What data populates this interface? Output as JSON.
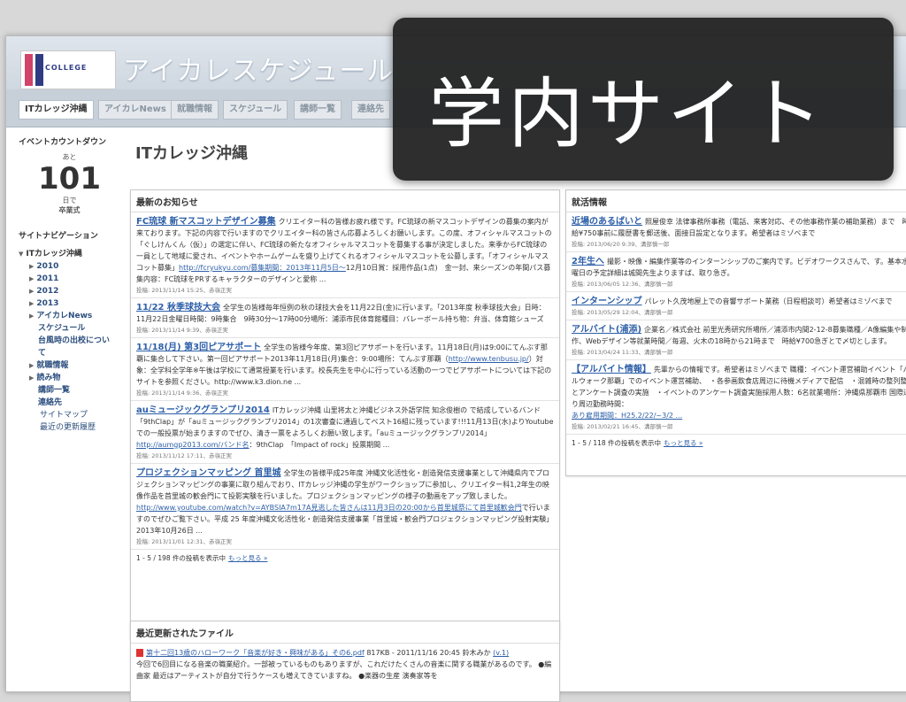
{
  "overlay": {
    "title": "学内サイト"
  },
  "site": {
    "logo_text": "COLLEGE",
    "title": "アイカレスケジュール"
  },
  "tabs": [
    "ITカレッジ沖縄",
    "アイカレNews",
    "就職情報",
    "スケジュール",
    "講師一覧",
    "連絡先"
  ],
  "sidebar": {
    "countdown_title": "イベントカウントダウン",
    "count_prefix": "あと",
    "count_value": "101",
    "count_unit": "日で",
    "count_event": "卒業式",
    "nav_title": "サイトナビゲーション",
    "nav": [
      {
        "label": "ITカレッジ沖縄",
        "level": 0,
        "arrow": "▼"
      },
      {
        "label": "2010",
        "level": 1,
        "arrow": "▶"
      },
      {
        "label": "2011",
        "level": 1,
        "arrow": "▶"
      },
      {
        "label": "2012",
        "level": 1,
        "arrow": "▶"
      },
      {
        "label": "2013",
        "level": 1,
        "arrow": "▶"
      },
      {
        "label": "アイカレNews",
        "level": 1,
        "arrow": "▶"
      },
      {
        "label": "スケジュール",
        "level": 2,
        "arrow": ""
      },
      {
        "label": "台風時の出校につい",
        "level": 2,
        "arrow": ""
      },
      {
        "label": "て",
        "level": 2,
        "arrow": ""
      },
      {
        "label": "就職情報",
        "level": 1,
        "arrow": "▶"
      },
      {
        "label": "読み物",
        "level": 1,
        "arrow": "▶"
      },
      {
        "label": "講師一覧",
        "level": 2,
        "arrow": ""
      },
      {
        "label": "連絡先",
        "level": 2,
        "arrow": ""
      },
      {
        "label": "サイトマップ",
        "level": 3,
        "arrow": ""
      },
      {
        "label": "最近の更新履歴",
        "level": 3,
        "arrow": ""
      }
    ]
  },
  "page_title": "ITカレッジ沖縄",
  "news": {
    "heading": "最新のお知らせ",
    "items": [
      {
        "title": "FC琉球 新マスコットデザイン募集",
        "body": "クリエイター科の皆様お疲れ様です。FC琉球の新マスコットデザインの募集の案内が来ております。下記の内容で行いますのでクリエイター科の皆さん応募よろしくお願いします。この度、オフィシャルマスコットの「ぐしけんくん（仮）」の選定に伴い、FC琉球の新たなオフィシャルマスコットを募集する事が決定しました。来季からFC琉球の一員として地域に愛され、イベントやホームゲームを盛り上げてくれるオフィシャルマスコットを公募します。「オフィシャルマスコット募集」",
        "link": "http://fcryukyu.com/募集期間：2013年11月5日〜",
        "tail": "12月10日賞：採用作品(1点)　金一封、来シーズンの年間パス募集内容：FC琉球をPRするキャラクターのデザインと愛称 ...",
        "meta": "投稿: 2013/11/14 15:25、赤嶺正実"
      },
      {
        "title": "11/22 秋季球技大会",
        "body": "全学生の皆様毎年恒例の秋の球技大会を11月22日(金)に行います。「2013年度 秋季球技大会」日時：11月22日金曜日時間：9時集合　9時30分〜17時00分場所：浦添市民体育館種目：バレーボール持ち物：弁当、体育館シューズ",
        "link": "",
        "tail": "",
        "meta": "投稿: 2013/11/14 9:39、赤嶺正実"
      },
      {
        "title": "11/18(月) 第3回ピアサポート",
        "body": "全学生の皆様今年度、第3回ピアサポートを行います。11月18日(月)は9:00にてんぶす那覇に集合して下さい。第一回ピアサポート2013年11月18日(月)集合：9:00場所：てんぶす那覇（",
        "link": "http://www.tenbusu.jp/",
        "tail": "）対象：全学科全学年※午後は学校にて通常授業を行います。校長先生を中心に行っている活動の一つでピアサポートについては下記のサイトを参照ください。http://www.k3.dion.ne ...",
        "meta": "投稿: 2013/11/14 9:36、赤嶺正実"
      },
      {
        "title": "auミュージックグランプリ2014",
        "body": "ITカレッジ沖縄 山里将太と沖縄ビジネス外語学院 知念俊樹の で結成しているバンド「9thClap」が「auミュージックグランプリ2014」の1次審査に通過してベスト16組に残っています!!!11月13日(水)よりYoutubeでの一般投票が始まりますのでぜひ、清き一票をよろしくお願い致します。「auミュージックグランプリ2014」",
        "link": "http://aumgp2013.com/バンド名",
        "tail": "：9thClap　「Impact of rock」投票期間 ...",
        "meta": "投稿: 2013/11/12 17:11、赤嶺正実"
      },
      {
        "title": "プロジェクションマッピング 首里城",
        "body": "全学生の皆様平成25年度 沖縄文化活性化・創造発信支援事業として沖縄県内でプロジェクションマッピングの事業に取り組んでおり、ITカレッジ沖縄の学生がワークショップに参加し、クリエイター科1,2年生の映像作品を首里城の歓会門にて投影実験を行いました。プロジェクションマッピングの様子の動画をアップ致しました。",
        "link": "http://www.youtube.com/watch?v=AYBSIA7m17A見逃した皆さんは11月3日の20:00から首里城祭にて首里城歓会門",
        "tail": "で行いますのでぜひご覧下さい。平成 25 年度沖縄文化活性化・創造発信支援事業「首里城・歓会門プロジェクションマッピング投射実験」2013年10月26日 ...",
        "meta": "投稿: 2013/11/01 12:31、赤嶺正実"
      }
    ],
    "footer": "1 - 5 / 198 件の投稿を表示中",
    "more": "もっと見る »"
  },
  "jobs": {
    "heading": "就活情報",
    "items": [
      {
        "title": "近場のあるばいと",
        "body": "照屋俊幸 法律事務所事務（電話、来客対応、その他事務作業の補助業務）まで　時給¥750事前に履歴書を郵送後、面接日設定となります。希望者はミゾベまで",
        "meta": "投稿: 2013/06/20 9:39、溝部慎一郎"
      },
      {
        "title": "2年生へ",
        "body": "撮影・映像・編集作業等のインターンシップのご案内です。ビデオワークスさんで、す。基本水曜日の予定詳細は城間先生よりますば、取り急ぎ。",
        "meta": "投稿: 2013/06/05 12:36、溝部慎一郎"
      },
      {
        "title": "インターンシップ",
        "body": "パレット久茂地屋上での音響サポート業務（日程相談可）希望者はミゾベまで",
        "meta": "投稿: 2013/05/29 12:04、溝部慎一郎"
      },
      {
        "title": "アルバイト(浦添)",
        "body": "企業名／株式会社 前里光秀研究所場所／浦添市内間2-12-8募集職種／A像編集や制作、Webデザイン等就業時間／毎週、火木の18時から21時まで　時給¥700急ぎとで〆切とします。",
        "meta": "投稿: 2013/04/24 11:33、溝部慎一郎"
      },
      {
        "title": "【アルバイト情報】",
        "body": "先輩からの情報です。希望者はミゾベまで 職種：イベント運営補助イベント「パルウォーク那覇」でのイベント運営補助、　・各参画飲食店周辺に待機メディアで配信　・混雑時の整列整理とアンケート調査の実施　・イベントのアンケート調査実施採用人数：6名就業場所：沖縄県那覇市 国際通り周辺勤務時間：",
        "tail": "あり雇用期間：H25.2/22/~3/2 ...",
        "meta": "投稿: 2013/02/21 16:45、溝部慎一郎"
      }
    ],
    "footer": "1 - 5 / 118 件の投稿を表示中",
    "more": "もっと見る »"
  },
  "files": {
    "heading": "最近更新されたファイル",
    "item_title": "第十二回13歳のハローワーク「音楽が好き・興味がある」その6.pdf",
    "item_info": "817KB - 2011/11/16 20:45 鈴木みか",
    "item_version": "(v.1)",
    "item_desc": "今回で6回目になる音楽の職業紹介。一部被っているものもありますが、これだけたくさんの音楽に関する職業があるのです。 ●編曲家 最近はアーティストが自分で行うケースも増えてきていますね。 ●楽器の生産 演奏家等を"
  }
}
